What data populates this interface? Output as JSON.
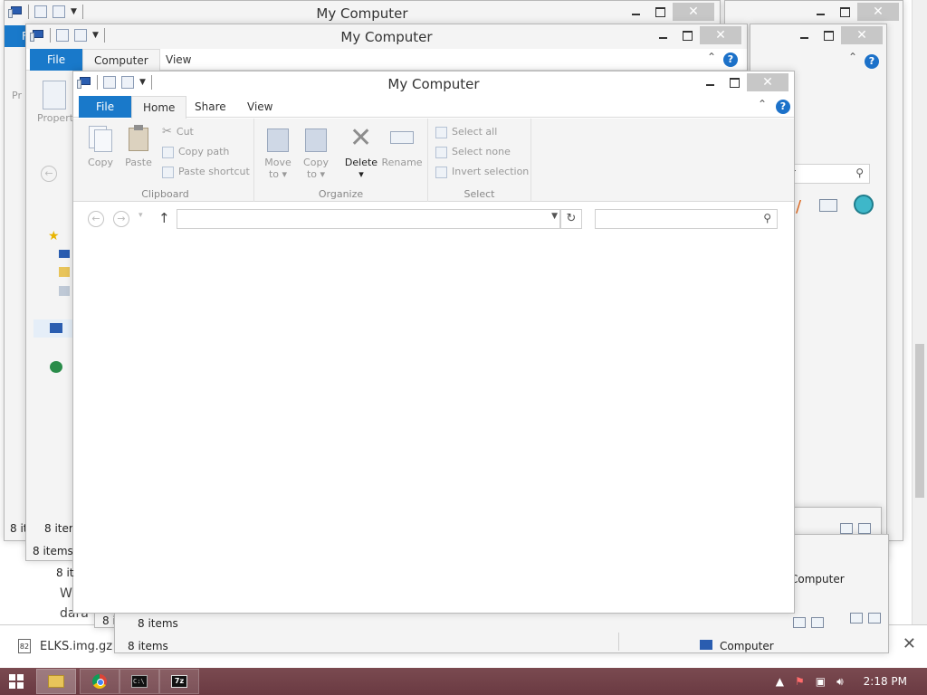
{
  "window_title": "My Computer",
  "ribbon_tabs": {
    "file": "File",
    "home": "Home",
    "share": "Share",
    "view": "View",
    "computer": "Computer"
  },
  "clipboard": {
    "copy": "Copy",
    "paste": "Paste",
    "cut": "Cut",
    "copy_path": "Copy path",
    "paste_shortcut": "Paste shortcut",
    "label": "Clipboard"
  },
  "organize": {
    "move_to": "Move",
    "move_to_2": "to",
    "copy_to": "Copy",
    "copy_to_2": "to",
    "delete": "Delete",
    "rename": "Rename",
    "label": "Organize"
  },
  "select": {
    "select_all": "Select all",
    "select_none": "Select none",
    "invert": "Invert selection",
    "label": "Select"
  },
  "back_ribbon": {
    "properties": "Properti",
    "properties_short": "Pr"
  },
  "status": {
    "items": "8 items",
    "items_trunc": "8 item",
    "items_trunc2": "8 it",
    "items_trunc3": "8 it",
    "computer": "Computer",
    "computer_trunc": "puter"
  },
  "background_page": {
    "line1": "W",
    "line2": "dara"
  },
  "download": {
    "file": "ELKS.img.gz"
  },
  "taskbar": {
    "time": "2:18 PM",
    "cmd_label": "C:\\",
    "sevenzip_label": "7z"
  },
  "icons": [
    "my-computer-icon",
    "properties-icon",
    "undo-icon",
    "dropdown-icon",
    "help-icon",
    "copy-icon",
    "paste-icon",
    "cut-icon",
    "copy-path-icon",
    "paste-shortcut-icon",
    "move-to-icon",
    "copy-to-icon",
    "delete-icon",
    "rename-icon",
    "select-all-icon",
    "select-none-icon",
    "invert-selection-icon",
    "back-icon",
    "forward-icon",
    "up-icon",
    "refresh-icon",
    "search-icon",
    "details-view-icon",
    "large-icons-view-icon",
    "start-icon",
    "file-explorer-icon",
    "chrome-icon",
    "cmd-icon",
    "7zip-icon",
    "flag-icon",
    "network-icon",
    "volume-icon"
  ],
  "colors": {
    "file_tab": "#1979ca",
    "help": "#1c71c9",
    "taskbar": "#6a3a42"
  }
}
